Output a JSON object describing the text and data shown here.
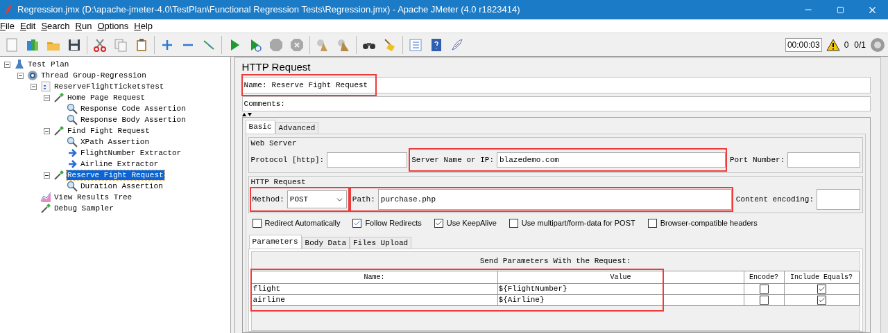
{
  "window": {
    "title": "Regression.jmx (D:\\apache-jmeter-4.0\\TestPlan\\Functional Regression Tests\\Regression.jmx) - Apache JMeter (4.0 r1823414)"
  },
  "menu": [
    "File",
    "Edit",
    "Search",
    "Run",
    "Options",
    "Help"
  ],
  "toolbar": {
    "timer": "00:00:03",
    "warnings": "0",
    "threads": "0/1"
  },
  "tree": [
    {
      "label": "Test Plan",
      "kind": "plan",
      "expanded": true,
      "selected": false,
      "children": [
        {
          "label": "Thread Group-Regression",
          "kind": "threadgroup",
          "expanded": true,
          "selected": false,
          "children": [
            {
              "label": "ReserveFlightTicketsTest",
              "kind": "controller",
              "expanded": true,
              "selected": false,
              "children": [
                {
                  "label": "Home Page Request",
                  "kind": "sampler",
                  "expanded": true,
                  "selected": false,
                  "children": [
                    {
                      "label": "Response Code Assertion",
                      "kind": "assertion",
                      "selected": false
                    },
                    {
                      "label": "Response Body Assertion",
                      "kind": "assertion",
                      "selected": false
                    }
                  ]
                },
                {
                  "label": "Find Fight Request",
                  "kind": "sampler",
                  "expanded": true,
                  "selected": false,
                  "children": [
                    {
                      "label": "XPath Assertion",
                      "kind": "assertion",
                      "selected": false
                    },
                    {
                      "label": "FlightNumber Extractor",
                      "kind": "extractor",
                      "selected": false
                    },
                    {
                      "label": "Airline Extractor",
                      "kind": "extractor",
                      "selected": false
                    }
                  ]
                },
                {
                  "label": "Reserve Fight Request",
                  "kind": "sampler",
                  "expanded": true,
                  "selected": true,
                  "children": [
                    {
                      "label": "Duration Assertion",
                      "kind": "assertion",
                      "selected": false
                    }
                  ]
                }
              ]
            },
            {
              "label": "View Results Tree",
              "kind": "listener",
              "selected": false
            },
            {
              "label": "Debug Sampler",
              "kind": "sampler",
              "selected": false
            }
          ]
        }
      ]
    }
  ],
  "panel": {
    "title": "HTTP Request",
    "name": {
      "label": "Name:",
      "value": "Reserve Fight Request",
      "highlighted": true
    },
    "comments": {
      "label": "Comments:"
    },
    "tabs": [
      {
        "label": "Basic",
        "selected": true
      },
      {
        "label": "Advanced",
        "selected": false
      }
    ],
    "web_server": {
      "legend": "Web Server",
      "protocol": {
        "label": "Protocol [http]:"
      },
      "server": {
        "label": "Server Name or IP:",
        "value": "blazedemo.com",
        "highlighted": true
      },
      "port": {
        "label": "Port Number:"
      }
    },
    "http_request": {
      "legend": "HTTP Request",
      "method": {
        "label": "Method:",
        "value": "POST",
        "highlighted": true
      },
      "path": {
        "label": "Path:",
        "value": "purchase.php",
        "highlighted": true
      },
      "encoding": {
        "label": "Content encoding:"
      }
    },
    "options": [
      {
        "label": "Redirect Automatically",
        "checked": false
      },
      {
        "label": "Follow Redirects",
        "checked": true
      },
      {
        "label": "Use KeepAlive",
        "checked": true
      },
      {
        "label": "Use multipart/form-data for POST",
        "checked": false
      },
      {
        "label": "Browser-compatible headers",
        "checked": false
      }
    ],
    "param_tabs": [
      {
        "label": "Parameters",
        "selected": true
      },
      {
        "label": "Body Data",
        "selected": false
      },
      {
        "label": "Files Upload",
        "selected": false
      }
    ],
    "parameters": {
      "caption": "Send Parameters With the Request:",
      "highlighted": true,
      "columns": [
        "Name:",
        "Value",
        "Encode?",
        "Include Equals?"
      ],
      "rows": [
        {
          "name": "flight",
          "value": "${FlightNumber}",
          "encode": false,
          "include_equals": true
        },
        {
          "name": "airline",
          "value": "${Airline}",
          "encode": false,
          "include_equals": true
        }
      ]
    }
  }
}
